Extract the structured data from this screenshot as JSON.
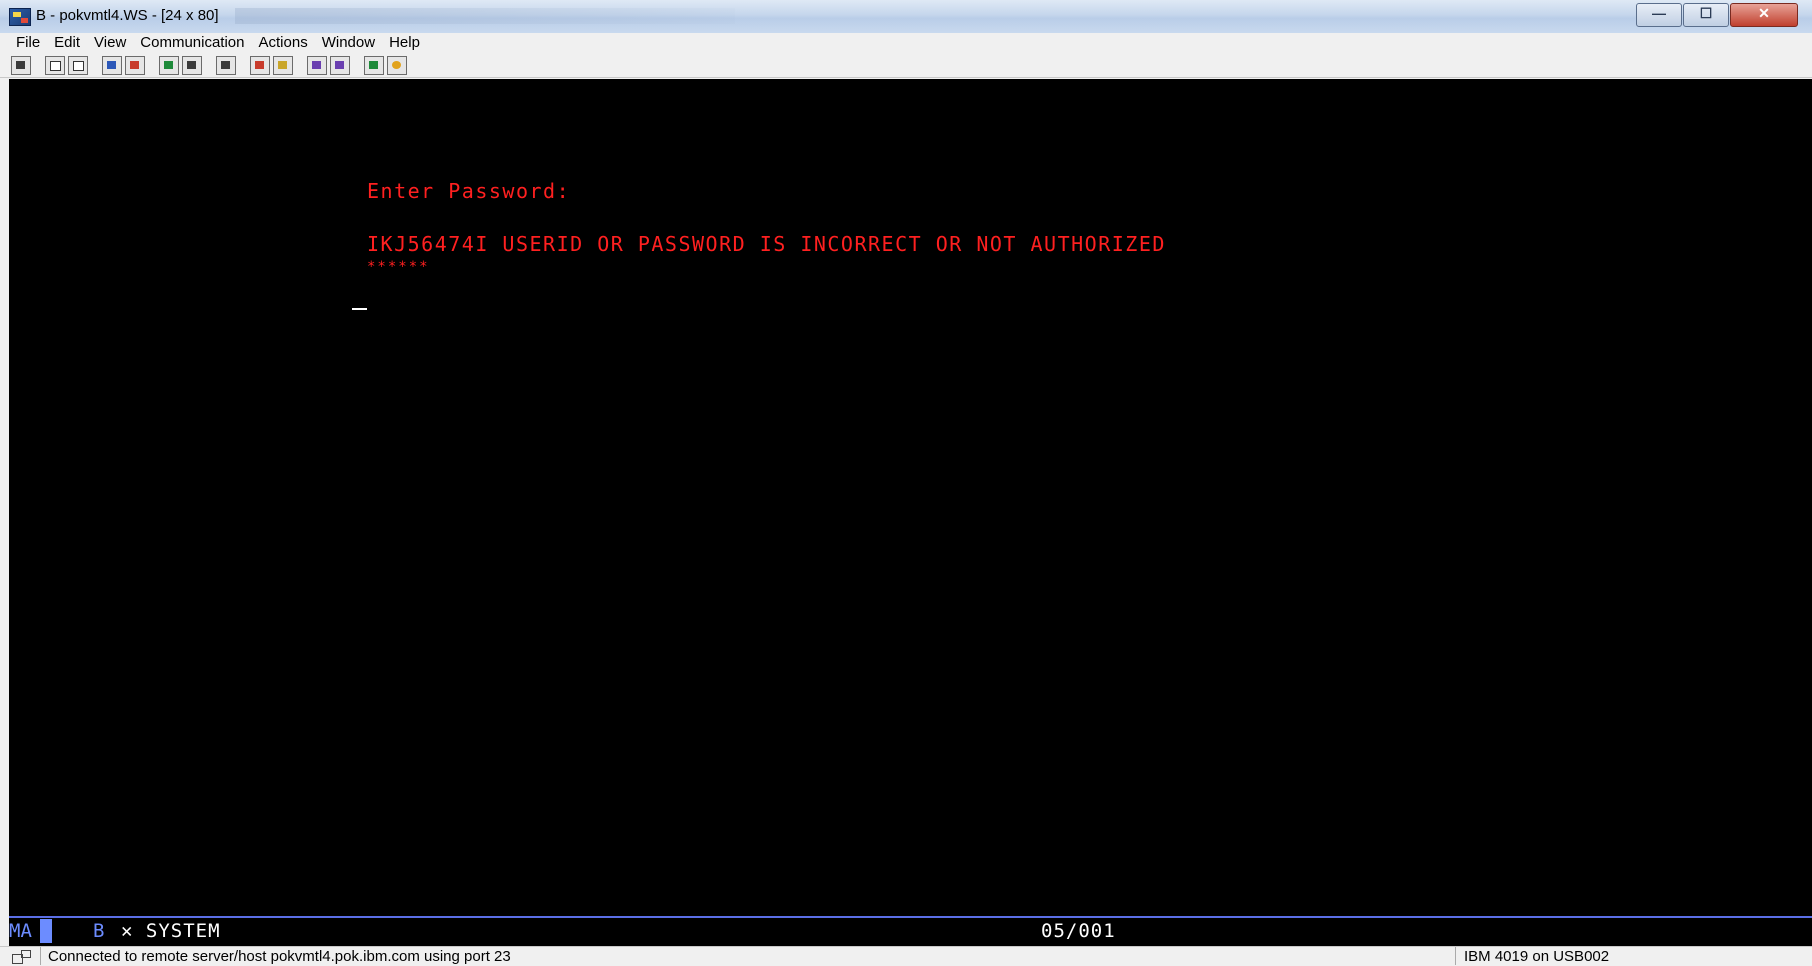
{
  "window": {
    "title": "B - pokvmtl4.WS - [24 x 80]",
    "controls": {
      "minimize": "—",
      "maximize": "☐",
      "close": "✕"
    }
  },
  "menu": {
    "items": [
      "File",
      "Edit",
      "View",
      "Communication",
      "Actions",
      "Window",
      "Help"
    ]
  },
  "toolbar": {
    "icons": [
      "print-screen-icon",
      "copy-icon",
      "paste-icon",
      "send-file-icon",
      "receive-file-icon",
      "display-setup-icon",
      "keyboard-map-icon",
      "macro-icon",
      "connect-icon",
      "disconnect-icon",
      "record-macro-icon",
      "play-macro-icon",
      "globe-icon",
      "help-icon"
    ]
  },
  "terminal": {
    "lines": {
      "prompt": "Enter Password:",
      "message": "IKJ56474I USERID OR PASSWORD IS INCORRECT OR NOT AUTHORIZED",
      "masked": "******"
    },
    "text_color": "#ff2020",
    "background": "#000000"
  },
  "oia": {
    "mode": "MA",
    "session": "B",
    "system_indicator": "✕ SYSTEM",
    "cursor_position": "05/001"
  },
  "status": {
    "connection": "Connected to remote server/host pokvmtl4.pok.ibm.com using port 23",
    "printer": "IBM 4019 on USB002"
  }
}
